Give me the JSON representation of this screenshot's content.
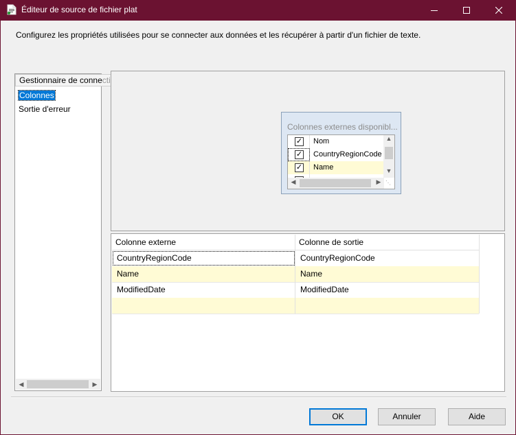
{
  "window": {
    "title": "Éditeur de source de fichier plat",
    "description": "Configurez les propriétés utilisées pour se connecter aux données et les récupérer à partir d'un fichier de texte."
  },
  "nav": {
    "tooltip_visible": "Gestionnaire de conne",
    "tooltip_faded": "ctions",
    "items": [
      {
        "label": "Colonnes",
        "selected": true
      },
      {
        "label": "Sortie d'erreur",
        "selected": false
      }
    ]
  },
  "available_columns": {
    "title": "Colonnes externes disponibl...",
    "items": [
      {
        "label": "Nom",
        "checked": true
      },
      {
        "label": "CountryRegionCode",
        "checked": true
      },
      {
        "label": "Name",
        "checked": true
      }
    ]
  },
  "grid": {
    "headers": [
      "Colonne externe",
      "Colonne de sortie"
    ],
    "rows": [
      {
        "external": "CountryRegionCode",
        "output": "CountryRegionCode"
      },
      {
        "external": "Name",
        "output": "Name"
      },
      {
        "external": "ModifiedDate",
        "output": "ModifiedDate"
      },
      {
        "external": "",
        "output": ""
      }
    ]
  },
  "buttons": {
    "ok": "OK",
    "cancel": "Annuler",
    "help": "Aide"
  },
  "icons": {
    "minimize": "minimize-icon",
    "maximize": "maximize-icon",
    "close": "close-icon"
  }
}
